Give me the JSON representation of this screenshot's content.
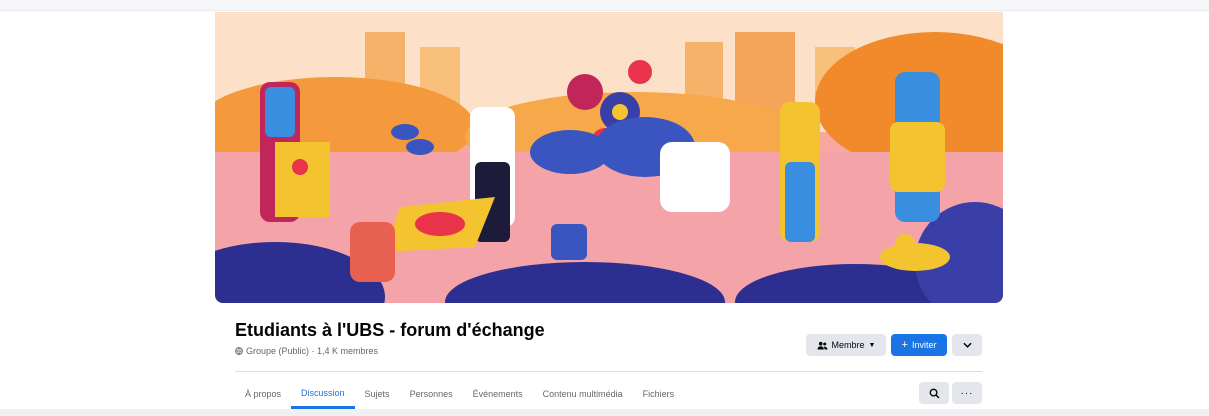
{
  "group": {
    "title": "Etudiants à l'UBS - forum d'échange",
    "subtitle": "Groupe (Public) · 1,4 K membres"
  },
  "actions": {
    "member_label": "Membre",
    "invite_label": "Inviter"
  },
  "tabs": [
    {
      "label": "À propos",
      "active": false
    },
    {
      "label": "Discussion",
      "active": true
    },
    {
      "label": "Sujets",
      "active": false
    },
    {
      "label": "Personnes",
      "active": false
    },
    {
      "label": "Événements",
      "active": false
    },
    {
      "label": "Contenu multimédia",
      "active": false
    },
    {
      "label": "Fichiers",
      "active": false
    }
  ],
  "icons": {
    "member": "people-icon",
    "dropdown": "caret-down-icon",
    "invite": "plus-icon",
    "more": "chevron-down-icon",
    "search": "search-icon",
    "options": "ellipsis-icon",
    "privacy": "globe-icon"
  },
  "colors": {
    "accent": "#1b74e4",
    "title": "#050505",
    "secondary_text": "#65676b",
    "button_gray": "#e4e6eb"
  }
}
